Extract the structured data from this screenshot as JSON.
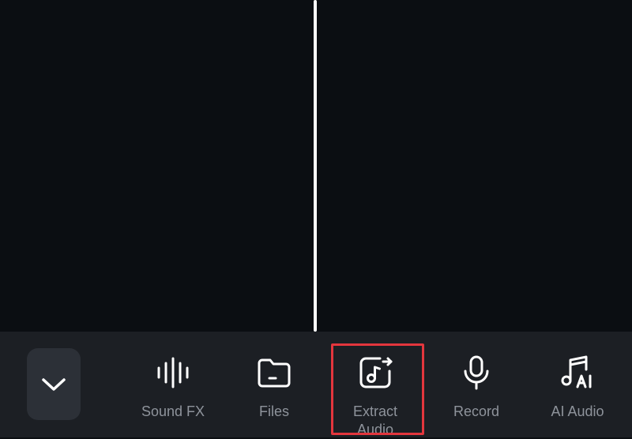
{
  "toolbar": {
    "collapse_icon": "chevron-down-icon",
    "tools": [
      {
        "label": "Sound FX",
        "icon": "waveform-icon"
      },
      {
        "label": "Files",
        "icon": "folder-icon"
      },
      {
        "label": "Extract\nAudio",
        "icon": "extract-audio-icon"
      },
      {
        "label": "Record",
        "icon": "microphone-icon"
      },
      {
        "label": "AI Audio",
        "icon": "music-ai-icon"
      }
    ]
  },
  "colors": {
    "background": "#0b0e12",
    "toolbar": "#1c1f24",
    "button": "#2c3037",
    "label": "#8e939b",
    "icon": "#ffffff",
    "highlight": "#e3363d"
  }
}
